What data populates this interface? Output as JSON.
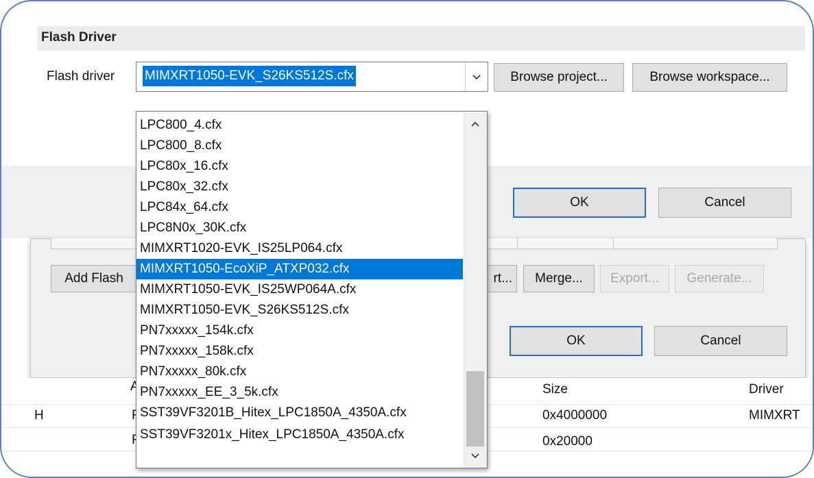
{
  "header": {
    "section_title": "Flash Driver"
  },
  "flash_driver": {
    "label": "Flash driver",
    "selected_value": "MIMXRT1050-EVK_S26KS512S.cfx",
    "browse_project_label": "Browse project...",
    "browse_workspace_label": "Browse workspace..."
  },
  "dialog_buttons": {
    "ok_label": "OK",
    "cancel_label": "Cancel"
  },
  "toolbar": {
    "add_flash_label": "Add Flash",
    "partial_button_label": "rt...",
    "merge_label": "Merge...",
    "export_label": "Export...",
    "generate_label": "Generate..."
  },
  "outer_dialog_buttons": {
    "ok_label": "OK",
    "cancel_label": "Cancel"
  },
  "table": {
    "header_partial": "A",
    "col_size": "Size",
    "col_driver": "Driver",
    "rows": [
      {
        "left_partial": "H",
        "mid_partial": "F",
        "size": "0x4000000",
        "driver": "MIMXRT"
      },
      {
        "left_partial": "",
        "mid_partial": "F",
        "size": "0x20000",
        "driver": ""
      }
    ]
  },
  "dropdown": {
    "items": [
      "LPC800_4.cfx",
      "LPC800_8.cfx",
      "LPC80x_16.cfx",
      "LPC80x_32.cfx",
      "LPC84x_64.cfx",
      "LPC8N0x_30K.cfx",
      "MIMXRT1020-EVK_IS25LP064.cfx",
      "MIMXRT1050-EcoXiP_ATXP032.cfx",
      "MIMXRT1050-EVK_IS25WP064A.cfx",
      "MIMXRT1050-EVK_S26KS512S.cfx",
      "PN7xxxxx_154k.cfx",
      "PN7xxxxx_158k.cfx",
      "PN7xxxxx_80k.cfx",
      "PN7xxxxx_EE_3_5k.cfx",
      "SST39VF3201B_Hitex_LPC1850A_4350A.cfx",
      "SST39VF3201x_Hitex_LPC1850A_4350A.cfx"
    ],
    "selected_index": 7
  },
  "colors": {
    "selection": "#0078d7",
    "focus_border": "#1f6fd0",
    "frame_border": "#5b7fc0"
  },
  "icons": {
    "dropdown_toggle": "chevron-down-icon",
    "scroll_up": "chevron-up-icon",
    "scroll_down": "chevron-down-icon"
  }
}
